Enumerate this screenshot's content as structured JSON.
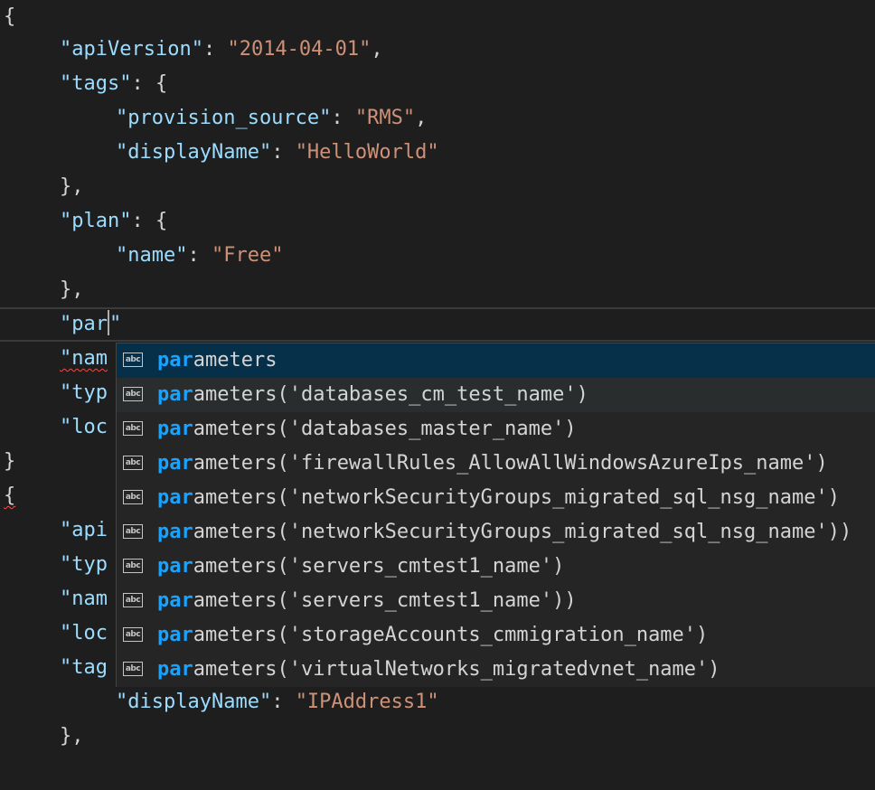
{
  "code": {
    "l0": "{",
    "apiVersion_key": "\"apiVersion\"",
    "apiVersion_val": "\"2014-04-01\"",
    "tags_key": "\"tags\"",
    "provision_source_key": "\"provision_source\"",
    "provision_source_val": "\"RMS\"",
    "displayName_key": "\"displayName\"",
    "displayName_val": "\"HelloWorld\"",
    "close_obj_comma": "},",
    "plan_key": "\"plan\"",
    "name_key": "\"name\"",
    "name_val": "\"Free\"",
    "typed_text": "\"par",
    "typed_close": "\"",
    "partial_nam": "\"nam",
    "partial_typ": "\"typ",
    "partial_loc": "\"loc",
    "close_brace": "}",
    "open_brace": "{",
    "partial_api": "\"api",
    "partial_typ2": "\"typ",
    "partial_nam2": "\"nam",
    "partial_loc2": "\"loc",
    "partial_tag": "\"tag",
    "displayName2_key": "\"displayName\"",
    "displayName2_val": "\"IPAddress1\"",
    "last_line": "},"
  },
  "suggestions": {
    "match_text": "par",
    "icon_label": "abc",
    "items": [
      "ameters",
      "ameters('databases_cm_test_name')",
      "ameters('databases_master_name')",
      "ameters('firewallRules_AllowAllWindowsAzureIps_name')",
      "ameters('networkSecurityGroups_migrated_sql_nsg_name')",
      "ameters('networkSecurityGroups_migrated_sql_nsg_name'))",
      "ameters('servers_cmtest1_name')",
      "ameters('servers_cmtest1_name'))",
      "ameters('storageAccounts_cmmigration_name')",
      "ameters('virtualNetworks_migratedvnet_name')"
    ]
  },
  "colors": {
    "background": "#1e1e1e",
    "key": "#9cdcfe",
    "string": "#ce9178",
    "match_highlight": "#18a3ff",
    "selected_item": "#062f4a",
    "error_squiggle": "#f14c4c"
  }
}
